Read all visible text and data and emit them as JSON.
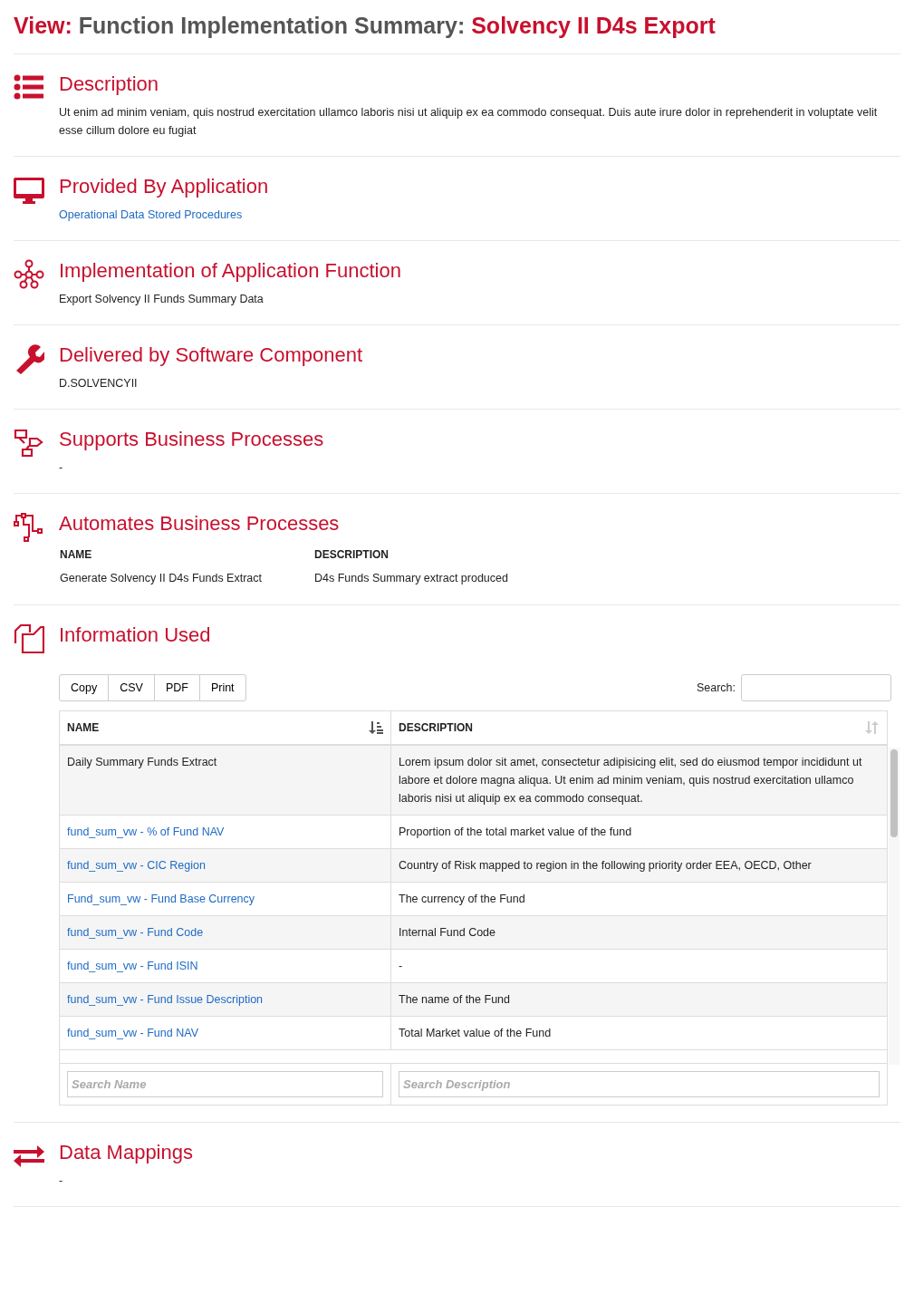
{
  "title": {
    "prefix": "View:",
    "name": "Function Implementation Summary:",
    "subject": "Solvency II D4s Export"
  },
  "sections": [
    {
      "kind": "text",
      "heading": "Description",
      "text": "Ut enim ad minim veniam, quis nostrud exercitation ullamco laboris nisi ut aliquip ex ea commodo consequat. Duis aute irure dolor in reprehenderit in voluptate velit esse cillum dolore eu fugiat"
    },
    {
      "kind": "link",
      "heading": "Provided By Application",
      "text": "Operational Data Stored Procedures"
    },
    {
      "kind": "text",
      "heading": "Implementation of Application Function",
      "text": "Export Solvency II Funds Summary Data"
    },
    {
      "kind": "text",
      "heading": "Delivered by Software Component",
      "text": "D.SOLVENCYII"
    },
    {
      "kind": "text",
      "heading": "Supports Business Processes",
      "text": "-"
    },
    {
      "kind": "table",
      "heading": "Automates Business Processes",
      "columns": [
        "NAME",
        "DESCRIPTION"
      ],
      "rows": [
        [
          "Generate Solvency II D4s Funds Extract",
          "D4s Funds Summary extract produced"
        ]
      ]
    },
    {
      "kind": "datatable",
      "heading": "Information Used",
      "buttons": [
        "Copy",
        "CSV",
        "PDF",
        "Print"
      ],
      "search_label": "Search:",
      "columns": [
        {
          "label": "NAME",
          "sorted": true
        },
        {
          "label": "DESCRIPTION",
          "sorted": false
        }
      ],
      "rows": [
        {
          "name": "Daily Summary Funds Extract",
          "link": false,
          "description": "Lorem ipsum dolor sit amet, consectetur adipisicing elit, sed do eiusmod tempor incididunt ut labore et dolore magna aliqua. Ut enim ad minim veniam, quis nostrud exercitation ullamco laboris nisi ut aliquip ex ea commodo consequat."
        },
        {
          "name": "fund_sum_vw - % of Fund NAV",
          "link": true,
          "description": "Proportion of the total market value of the fund"
        },
        {
          "name": "fund_sum_vw - CIC Region",
          "link": true,
          "description": "Country of Risk mapped to region in the following priority order EEA, OECD, Other"
        },
        {
          "name": "Fund_sum_vw - Fund Base Currency",
          "link": true,
          "description": "The currency of the Fund"
        },
        {
          "name": "fund_sum_vw - Fund Code",
          "link": true,
          "description": "Internal Fund Code"
        },
        {
          "name": "fund_sum_vw - Fund ISIN",
          "link": true,
          "description": "-"
        },
        {
          "name": "fund_sum_vw - Fund Issue Description",
          "link": true,
          "description": "The name of the Fund"
        },
        {
          "name": "fund_sum_vw - Fund NAV",
          "link": true,
          "description": "Total Market value of the Fund"
        }
      ],
      "filters": [
        {
          "placeholder": "Search Name"
        },
        {
          "placeholder": "Search Description"
        }
      ]
    },
    {
      "kind": "text",
      "heading": "Data Mappings",
      "text": "-"
    }
  ]
}
